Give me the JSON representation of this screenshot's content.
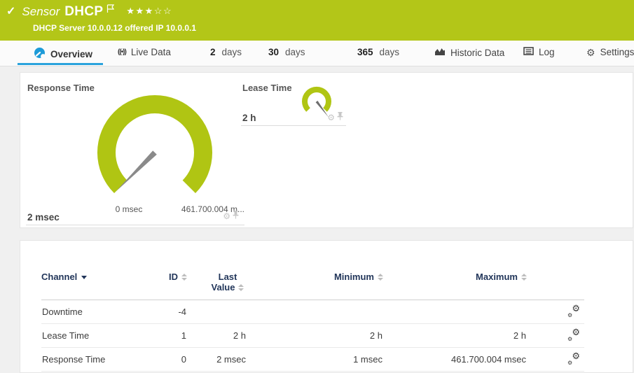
{
  "banner": {
    "check_icon": "✓",
    "type_label": "Sensor",
    "sensor_name": "DHCP",
    "stars_filled": "★★★",
    "stars_empty": "☆☆",
    "subtitle": "DHCP Server 10.0.0.12 offered IP 10.0.0.1",
    "bg_color": "#b3c618"
  },
  "tabs": {
    "overview": "Overview",
    "live_data": "Live Data",
    "d2_num": "2",
    "d2_word": "days",
    "d30_num": "30",
    "d30_word": "days",
    "d365_num": "365",
    "d365_word": "days",
    "historic": "Historic Data",
    "log": "Log",
    "settings": "Settings"
  },
  "gauges": {
    "color": "#b0c513",
    "response_time": {
      "title": "Response Time",
      "value": "2 msec",
      "min_label": "0 msec",
      "max_label": "461.700.004 m..."
    },
    "lease_time": {
      "title": "Lease Time",
      "value": "2 h"
    }
  },
  "table": {
    "headers": {
      "channel": "Channel",
      "id": "ID",
      "last_value": "Last Value",
      "minimum": "Minimum",
      "maximum": "Maximum"
    },
    "rows": [
      {
        "channel": "Downtime",
        "id": "-4",
        "last": "",
        "min": "",
        "max": ""
      },
      {
        "channel": "Lease Time",
        "id": "1",
        "last": "2 h",
        "min": "2 h",
        "max": "2 h"
      },
      {
        "channel": "Response Time",
        "id": "0",
        "last": "2 msec",
        "min": "1 msec",
        "max": "461.700.004 msec"
      }
    ]
  }
}
